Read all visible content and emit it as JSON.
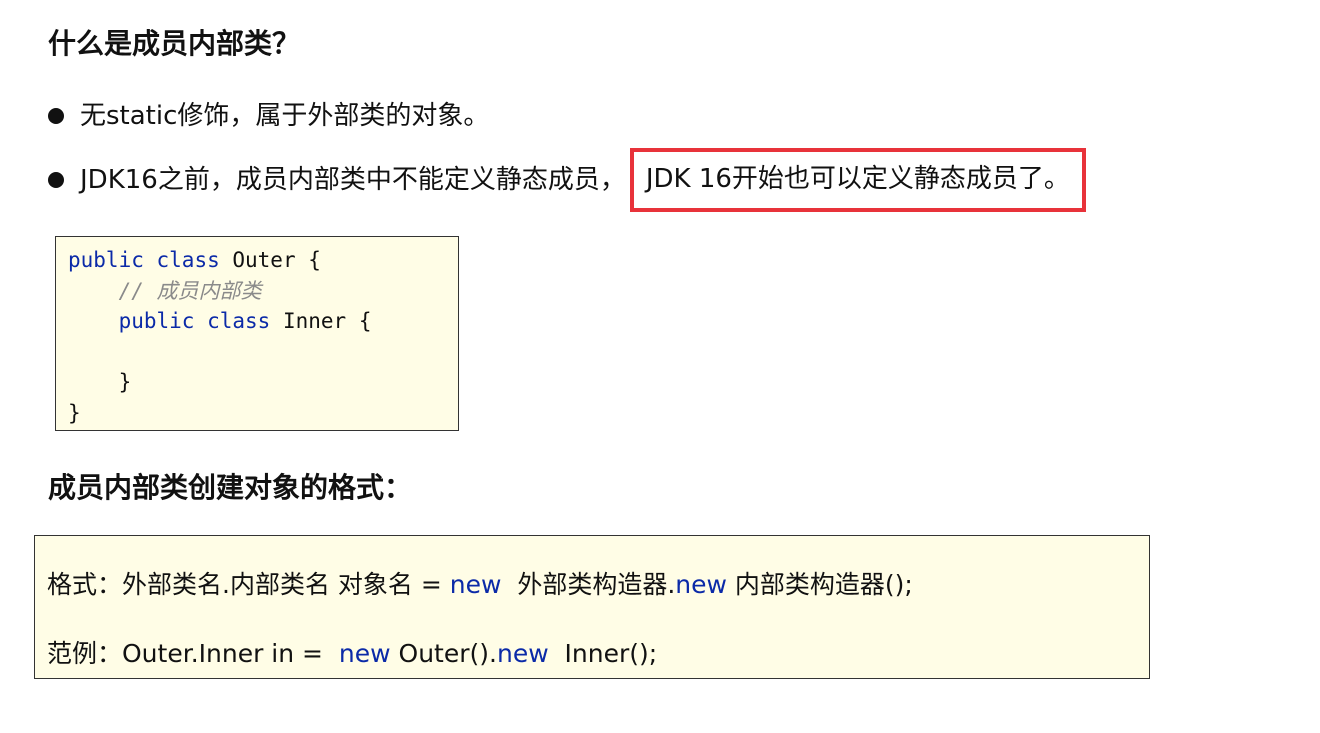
{
  "headings": {
    "what_is": "什么是成员内部类？",
    "create_format": "成员内部类创建对象的格式："
  },
  "bullets": [
    {
      "text": "无static修饰，属于外部类的对象。"
    },
    {
      "text_before": "JDK16之前，成员内部类中不能定义静态成员，",
      "highlighted": "JDK 16开始也可以定义静态成员了。"
    }
  ],
  "highlight_color": "#e8323a",
  "code": {
    "line1": {
      "kw1": "public",
      "kw2": "class",
      "rest": " Outer {"
    },
    "line2": {
      "comment": "// 成员内部类"
    },
    "line3": {
      "kw1": "public",
      "kw2": "class",
      "rest": " Inner {"
    },
    "line4": "",
    "line5": "}",
    "line6": "}"
  },
  "format": {
    "line1": {
      "part1": "格式：外部类名.内部类名 对象名 = ",
      "new1": "new",
      "part2": "  外部类构造器.",
      "new2": "new",
      "part3": " 内部类构造器();"
    },
    "line2": {
      "part1": "范例：Outer.Inner in =  ",
      "new1": "new",
      "part2": " Outer().",
      "new2": "new",
      "part3": "  Inner();"
    }
  },
  "keyword_color": "#0b2aa8"
}
